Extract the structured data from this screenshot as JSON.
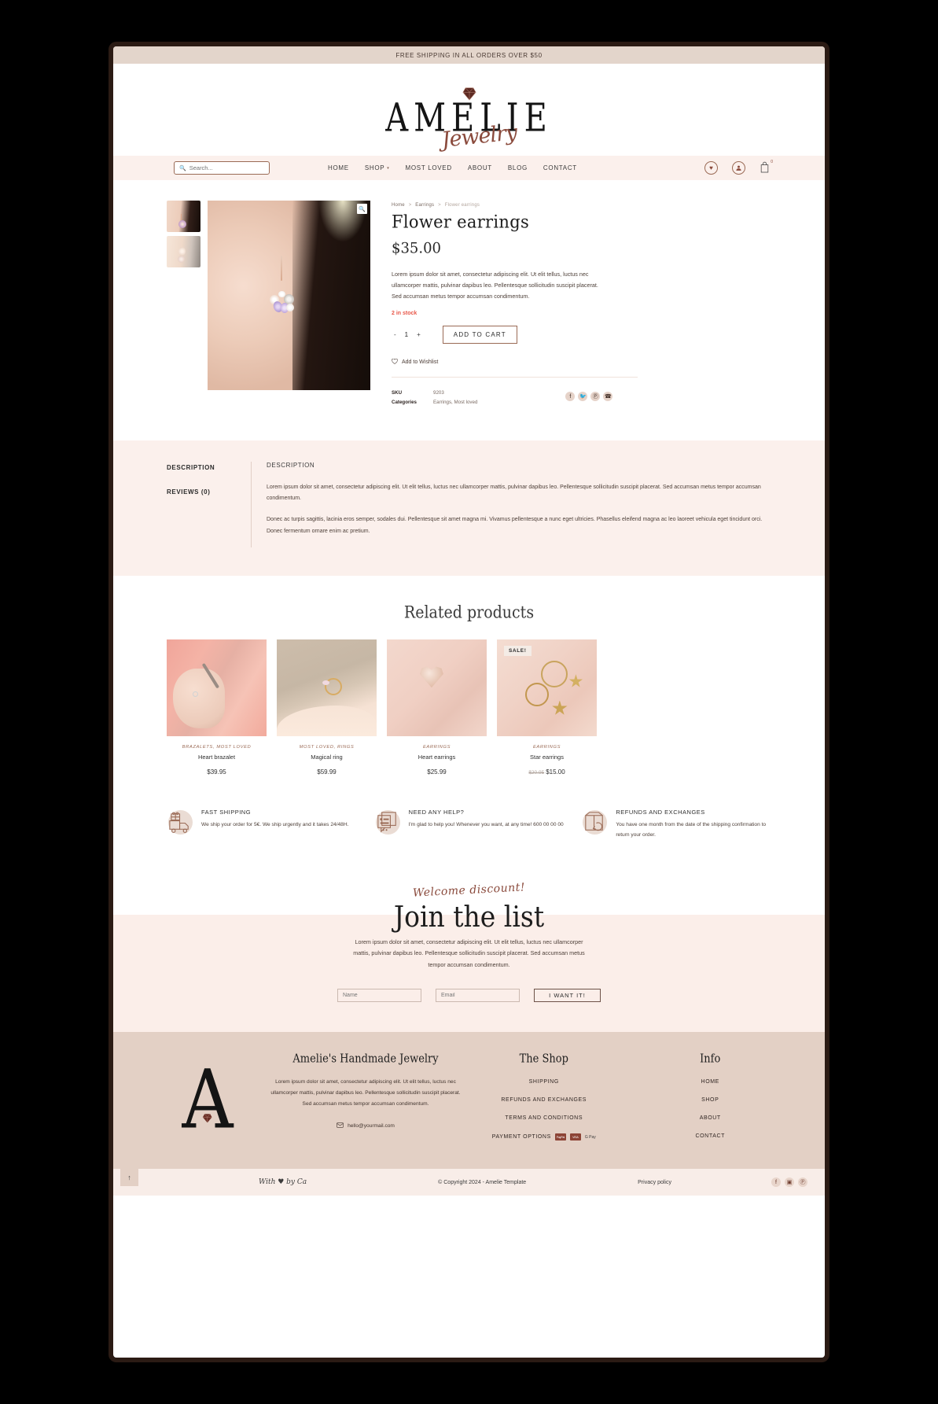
{
  "announcement": "FREE SHIPPING IN ALL ORDERS OVER $50",
  "brand": {
    "word": "AMELIE",
    "script": "Jewelry"
  },
  "nav": {
    "search_placeholder": "Search...",
    "links": [
      {
        "label": "HOME",
        "caret": ""
      },
      {
        "label": "SHOP",
        "caret": "▾"
      },
      {
        "label": "MOST LOVED",
        "caret": ""
      },
      {
        "label": "ABOUT",
        "caret": ""
      },
      {
        "label": "BLOG",
        "caret": ""
      },
      {
        "label": "CONTACT",
        "caret": ""
      }
    ],
    "wishlist_icon": "♥",
    "account_icon": "●",
    "bag_icon": "⌂",
    "bag_count": "0"
  },
  "product": {
    "breadcrumb": {
      "home": "Home",
      "category": "Earrings",
      "current": "Flower earrings"
    },
    "title": "Flower earrings",
    "price": "$35.00",
    "description": "Lorem ipsum dolor sit amet, consectetur adipiscing elit. Ut elit tellus, luctus nec ullamcorper mattis, pulvinar dapibus leo. Pellentesque sollicitudin suscipit placerat. Sed accumsan metus tempor accumsan condimentum.",
    "stock": "2 in stock",
    "qty_minus": "-",
    "qty_value": "1",
    "qty_plus": "+",
    "add_to_cart": "ADD TO CART",
    "wishlist": "Add to Wishlist",
    "sku_label": "SKU",
    "sku_value": "9203",
    "categories_label": "Categories",
    "categories_value": "Earrings, Most loved",
    "share": [
      "f",
      "✉",
      "Ⓟ",
      "☎"
    ]
  },
  "tabs": {
    "description_tab": "DESCRIPTION",
    "reviews_tab": "REVIEWS (0)",
    "panel_heading": "DESCRIPTION",
    "paragraphs": [
      "Lorem ipsum dolor sit amet, consectetur adipiscing elit. Ut elit tellus, luctus nec ullamcorper mattis, pulvinar dapibus leo. Pellentesque sollicitudin suscipit placerat. Sed accumsan metus tempor accumsan condimentum.",
      "Donec ac turpis sagittis, lacinia eros semper, sodales dui. Pellentesque sit amet magna mi. Vivamus pellentesque a nunc eget ultricies. Phasellus eleifend magna ac leo laoreet vehicula eget tincidunt orci. Donec fermentum ornare enim ac pretium."
    ]
  },
  "related": {
    "heading": "Related products",
    "items": [
      {
        "category": "BRAZALETS, MOST LOVED",
        "name": "Heart brazalet",
        "price": "$39.95",
        "old_price": "",
        "badge": ""
      },
      {
        "category": "MOST LOVED, RINGS",
        "name": "Magical ring",
        "price": "$59.99",
        "old_price": "",
        "badge": ""
      },
      {
        "category": "EARRINGS",
        "name": "Heart earrings",
        "price": "$25.99",
        "old_price": "",
        "badge": ""
      },
      {
        "category": "EARRINGS",
        "name": "Star earrings",
        "price": "$15.00",
        "old_price": "$20.95",
        "badge": "SALE!"
      }
    ]
  },
  "features": [
    {
      "icon": "truck-gift-icon",
      "title": "FAST SHIPPING",
      "text": "We ship your order for 5€. We ship urgently and it takes 24/48H."
    },
    {
      "icon": "chat-bubble-icon",
      "title": "NEED ANY HELP?",
      "text": "I'm glad to help you! Whenever you want, at any time! 600 00 00 00"
    },
    {
      "icon": "return-box-icon",
      "title": "REFUNDS AND EXCHANGES",
      "text": "You have one month from the date of the shipping confirmation to return your order."
    }
  ],
  "newsletter": {
    "script": "Welcome discount!",
    "heading": "Join the list",
    "text": "Lorem ipsum dolor sit amet, consectetur adipiscing elit. Ut elit tellus, luctus nec ullamcorper mattis, pulvinar dapibus leo. Pellentesque sollicitudin suscipit placerat. Sed accumsan metus tempor accumsan condimentum.",
    "name_placeholder": "Name",
    "email_placeholder": "Email",
    "button": "I WANT IT!"
  },
  "footer": {
    "logo_letter": "A",
    "about_title": "Amelie's Handmade Jewelry",
    "about_text": "Lorem ipsum dolor sit amet, consectetur adipiscing elit. Ut elit tellus, luctus nec ullamcorper mattis, pulvinar dapibus leo. Pellentesque sollicitudin suscipit placerat. Sed accumsan metus tempor accumsan condimentum.",
    "email": "hello@yourmail.com",
    "shop": {
      "title": "The Shop",
      "links": [
        "SHIPPING",
        "REFUNDS AND EXCHANGES",
        "TERMS AND CONDITIONS"
      ],
      "payment_label": "PAYMENT OPTIONS",
      "payment_methods": [
        "PayPal",
        "VISA",
        "G Pay"
      ]
    },
    "info": {
      "title": "Info",
      "links": [
        "HOME",
        "SHOP",
        "ABOUT",
        "CONTACT"
      ]
    }
  },
  "bottom": {
    "to_top_icon": "↑",
    "made_by": "With ♥ by Ca",
    "copyright": "© Copyright 2024 - Amelie Template",
    "privacy": "Privacy policy",
    "socials": [
      "f",
      "▣",
      "Ⓟ"
    ]
  },
  "colors": {
    "announce_bg": "#e3d5cb",
    "nav_bg": "#fbf0ec",
    "accent": "#8a4a3c",
    "section_bg": "#fbf0ec",
    "footer_bg": "#e3d0c5",
    "stock": "#e8584a"
  }
}
